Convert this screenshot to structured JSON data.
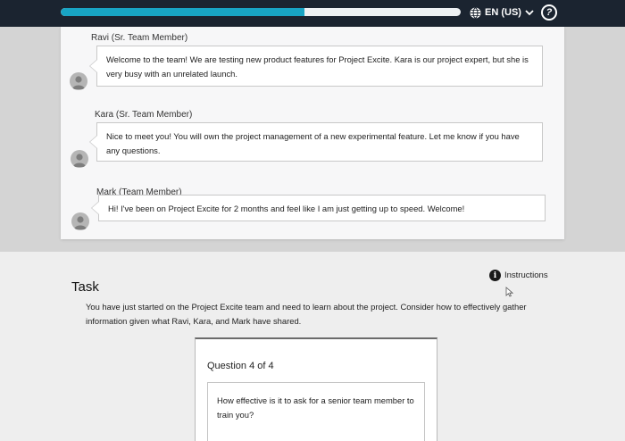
{
  "header": {
    "progress": 0.61,
    "language_label": "EN (US)",
    "language_icon": "globe-icon",
    "help_label": "?",
    "colors": {
      "bar": "#1b2430",
      "progress": "#18a4c4",
      "track": "#eef1f3"
    }
  },
  "conversation": [
    {
      "speaker": "Ravi (Sr. Team Member)",
      "message": "Welcome to the team! We are testing new product features for Project Excite. Kara is our project expert, but she is very busy with an unrelated launch."
    },
    {
      "speaker": "Kara (Sr. Team Member)",
      "message": "Nice to meet you! You will own the project management of a new experimental feature. Let me know if you have any questions."
    },
    {
      "speaker": "Mark (Team Member)",
      "message": "Hi! I've been on Project Excite for 2 months and feel like I am just getting up to speed. Welcome!"
    }
  ],
  "task": {
    "title": "Task",
    "instructions_label": "Instructions",
    "description": "You have just started on the Project Excite team and need to learn about the project. Consider how to effectively gather information given what Ravi, Kara, and Mark have shared.",
    "question_count": "Question 4 of 4",
    "question_text": "How effective is it to ask for a senior team member to train you?"
  }
}
